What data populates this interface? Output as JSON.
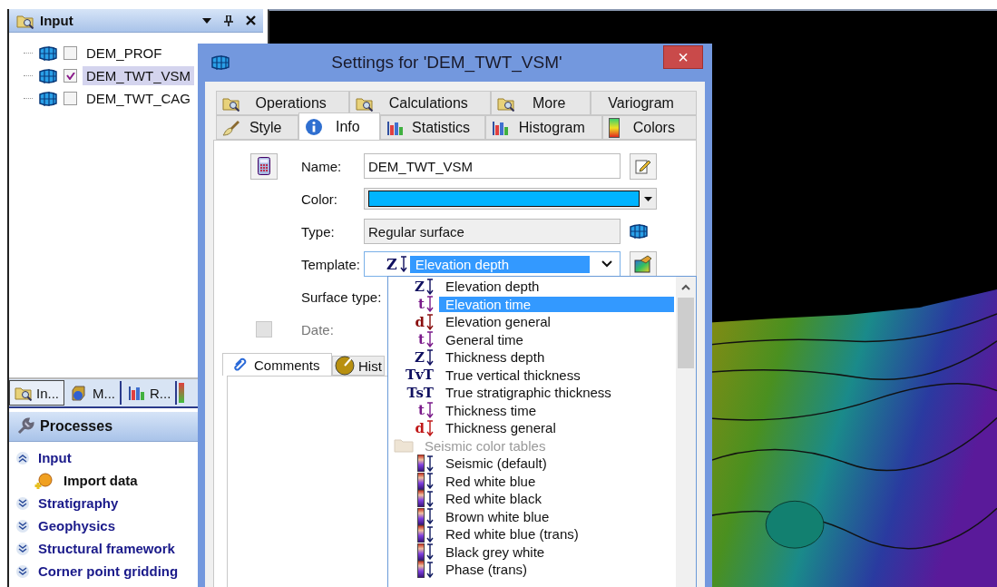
{
  "input_panel": {
    "title": "Input",
    "items": [
      {
        "label": "DEM_PROF",
        "checked": false,
        "selected": false
      },
      {
        "label": "DEM_TWT_VSM",
        "checked": true,
        "selected": true
      },
      {
        "label": "DEM_TWT_CAG",
        "checked": false,
        "selected": false
      }
    ]
  },
  "panel_tabs": [
    {
      "label": "In...",
      "selected": true
    },
    {
      "label": "M...",
      "selected": false
    },
    {
      "label": "R...",
      "selected": false
    }
  ],
  "processes": {
    "title": "Processes",
    "items": [
      {
        "label": "Input",
        "expanded": true,
        "children": [
          {
            "label": "Import data"
          }
        ]
      },
      {
        "label": "Stratigraphy",
        "expanded": false
      },
      {
        "label": "Geophysics",
        "expanded": false
      },
      {
        "label": "Structural framework",
        "expanded": false
      },
      {
        "label": "Corner point gridding",
        "expanded": false
      }
    ]
  },
  "dialog": {
    "title": "Settings for 'DEM_TWT_VSM'",
    "close": "×",
    "tabs_row_1": [
      {
        "label": "Operations",
        "selected": false
      },
      {
        "label": "Calculations",
        "selected": false
      },
      {
        "label": "More",
        "selected": false
      },
      {
        "label": "Variogram",
        "selected": false
      }
    ],
    "tabs_row_2": [
      {
        "label": "Style",
        "selected": false
      },
      {
        "label": "Info",
        "selected": true
      },
      {
        "label": "Statistics",
        "selected": false
      },
      {
        "label": "Histogram",
        "selected": false
      },
      {
        "label": "Colors",
        "selected": false
      }
    ],
    "name": {
      "label": "Name:",
      "value": "DEM_TWT_VSM"
    },
    "color": {
      "label": "Color:",
      "color": "#00b4ff"
    },
    "type": {
      "label": "Type:",
      "value": "Regular surface"
    },
    "template": {
      "label": "Template:",
      "symbol": "Z",
      "value": "Elevation depth"
    },
    "surface_type": {
      "label": "Surface type:"
    },
    "date": {
      "label": "Date:",
      "checked": false,
      "disabled": true
    },
    "sub_tabs": [
      {
        "label": "Comments",
        "selected": true
      },
      {
        "label": "Hist",
        "selected": false
      }
    ],
    "template_list": [
      {
        "kind": "template",
        "symbol": "Z",
        "color": "#101060",
        "arrow": true,
        "label": "Elevation depth",
        "selected": false
      },
      {
        "kind": "template",
        "symbol": "t",
        "color": "#7a1a8a",
        "arrow": true,
        "label": "Elevation time",
        "selected": true
      },
      {
        "kind": "template",
        "symbol": "d",
        "color": "#8a1010",
        "arrow": true,
        "label": "Elevation general",
        "selected": false
      },
      {
        "kind": "template",
        "symbol": "t",
        "color": "#7a1a8a",
        "arrow": true,
        "label": "General time",
        "selected": false
      },
      {
        "kind": "template",
        "symbol": "Z",
        "color": "#101060",
        "arrow": true,
        "label": "Thickness depth",
        "selected": false
      },
      {
        "kind": "template",
        "symbol": "TvT",
        "color": "#101060",
        "arrow": false,
        "label": "True vertical thickness",
        "selected": false
      },
      {
        "kind": "template",
        "symbol": "TsT",
        "color": "#101060",
        "arrow": false,
        "label": "True stratigraphic thickness",
        "selected": false
      },
      {
        "kind": "template",
        "symbol": "t",
        "color": "#7a1a8a",
        "arrow": true,
        "label": "Thickness time",
        "selected": false
      },
      {
        "kind": "template",
        "symbol": "d",
        "color": "#c01818",
        "arrow": true,
        "label": "Thickness general",
        "selected": false
      },
      {
        "kind": "group",
        "label": "Seismic color tables",
        "selected": false
      },
      {
        "kind": "colortable",
        "label": "Seismic (default)",
        "selected": false
      },
      {
        "kind": "colortable",
        "label": "Red white blue",
        "selected": false
      },
      {
        "kind": "colortable",
        "label": "Red white black",
        "selected": false
      },
      {
        "kind": "colortable",
        "label": "Brown white blue",
        "selected": false
      },
      {
        "kind": "colortable",
        "label": "Red white blue (trans)",
        "selected": false
      },
      {
        "kind": "colortable",
        "label": "Black grey white",
        "selected": false
      },
      {
        "kind": "colortable",
        "label": "Phase (trans)",
        "selected": false
      }
    ]
  }
}
